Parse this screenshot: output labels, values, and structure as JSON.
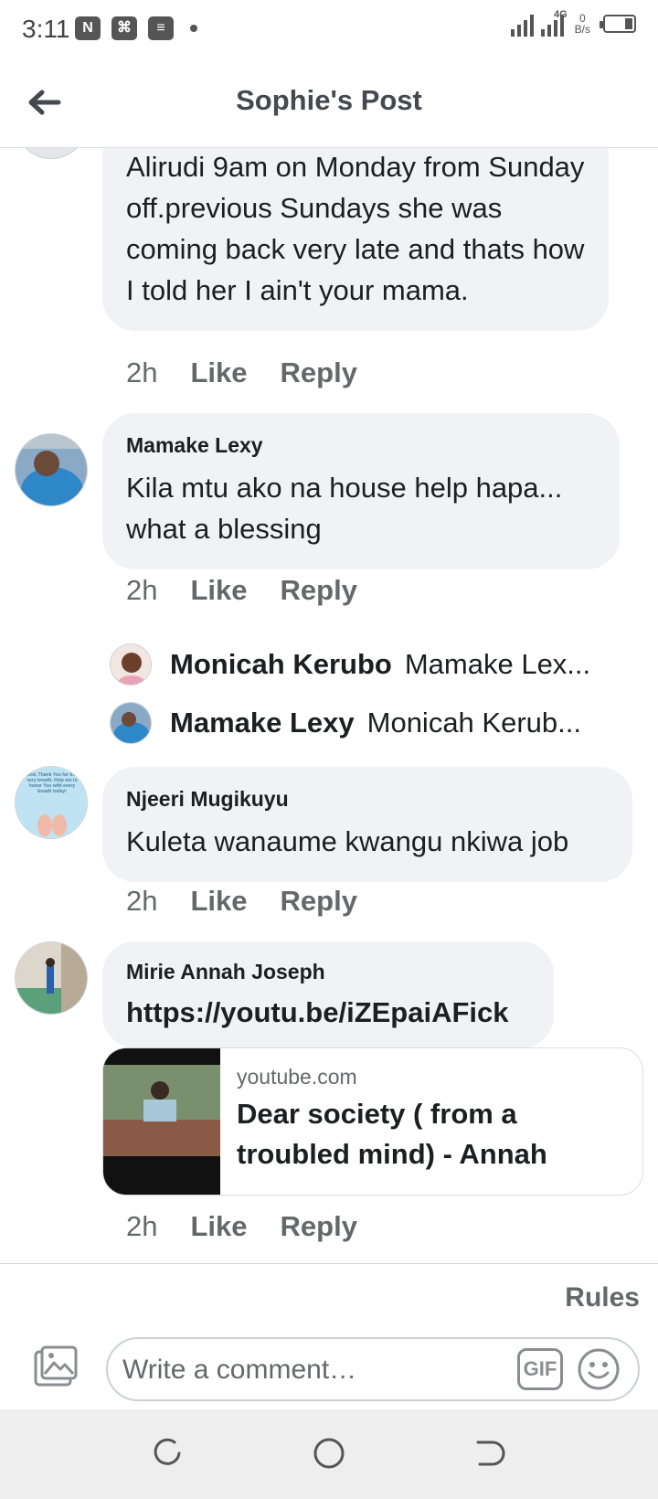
{
  "status_bar": {
    "time": "3:11",
    "network_type": "4G",
    "net_speed_value": "0",
    "net_speed_unit": "B/s"
  },
  "header": {
    "title": "Sophie's Post"
  },
  "comments": [
    {
      "text": "Alirudi 9am on Monday from Sunday off.previous Sundays she was coming back very late and thats how I told her I ain't your mama.",
      "time": "2h",
      "like_label": "Like",
      "reply_label": "Reply"
    },
    {
      "author": "Mamake Lexy",
      "text": "Kila mtu ako na house help hapa... what a blessing",
      "time": "2h",
      "like_label": "Like",
      "reply_label": "Reply",
      "replies": [
        {
          "author": "Monicah Kerubo",
          "preview": "Mamake Lex..."
        },
        {
          "author": "Mamake Lexy",
          "preview": "Monicah Kerub..."
        }
      ]
    },
    {
      "author": "Njeeri Mugikuyu",
      "text": "Kuleta wanaume kwangu nkiwa job",
      "time": "2h",
      "like_label": "Like",
      "reply_label": "Reply"
    },
    {
      "author": "Mirie Annah Joseph",
      "link": "https://youtu.be/iZEpaiAFick",
      "link_card": {
        "domain": "youtube.com",
        "title": "Dear society ( from a troubled mind) - Annah"
      },
      "time": "2h",
      "like_label": "Like",
      "reply_label": "Reply"
    }
  ],
  "avatar_text": {
    "njeeri": "God, Thank You for this very breath. Help me to honor You with every breath today!"
  },
  "composer": {
    "rules_label": "Rules",
    "placeholder": "Write a comment…",
    "gif_label": "GIF"
  },
  "colors": {
    "bubble_bg": "#f0f2f5",
    "secondary_text": "#65676b",
    "primary_text": "#1c1e21"
  }
}
